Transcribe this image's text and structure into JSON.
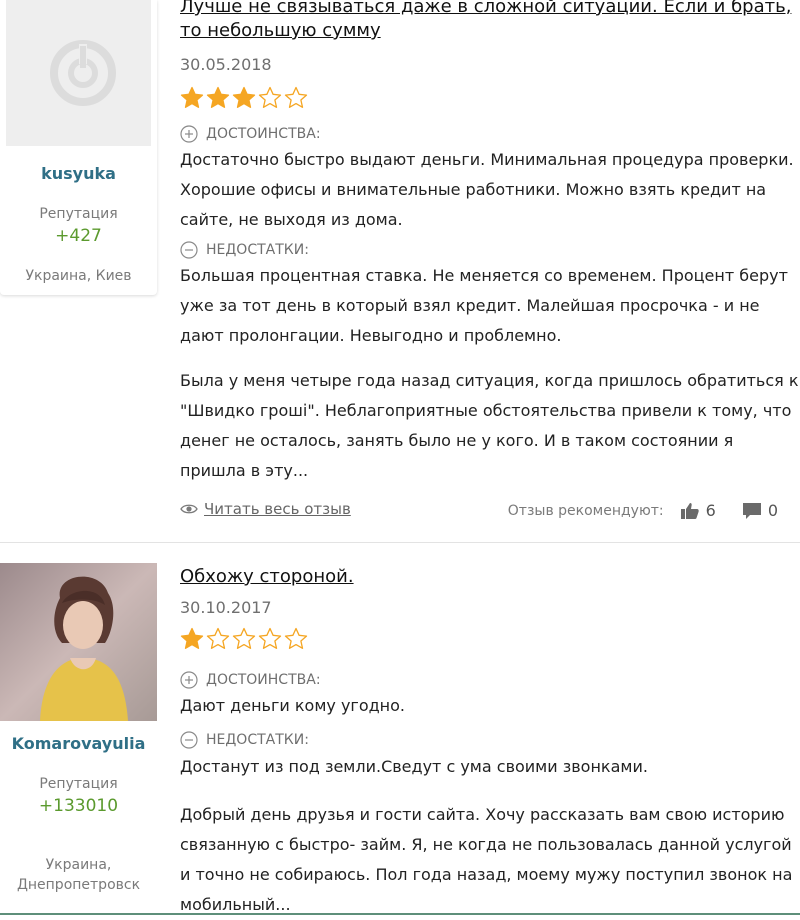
{
  "reviews": [
    {
      "author": {
        "name": "kusyuka",
        "reputation_label": "Репутация",
        "reputation": "+427",
        "city": "Украина, Киев"
      },
      "title": "Лучше не связываться даже в сложной ситуации. Если и брать,\nто небольшую сумму",
      "date": "30.05.2018",
      "rating": 3,
      "pros_label": "ДОСТОИНСТВА:",
      "pros": "Достаточно быстро выдают деньги. Минимальная процедура проверки. Хорошие офисы и внимательные работники. Можно взять кредит на сайте, не выходя из дома.",
      "cons_label": "НЕДОСТАТКИ:",
      "cons": "Большая процентная ставка. Не меняется со временем. Процент берут уже за тот день в который взял кредит. Малейшая просрочка - и не дают пролонгации. Невыгодно и проблемно.",
      "excerpt": "Была у меня четыре года назад ситуация, когда пришлось обратиться к \"Швидко гроші\". Неблагоприятные обстоятельства привели к тому, что денег не осталось, занять было не у кого. И в таком состоянии я пришла в эту...",
      "read_more": "Читать весь отзыв",
      "recommend_label": "Отзыв рекомендуют:",
      "likes": "6",
      "comments": "0"
    },
    {
      "author": {
        "name": "Komarovayulia",
        "reputation_label": "Репутация",
        "reputation": "+133010",
        "city": "Украина,\nДнепропетровск"
      },
      "title": "Обхожу стороной.",
      "date": "30.10.2017",
      "rating": 1,
      "pros_label": "ДОСТОИНСТВА:",
      "pros": "Дают деньги кому угодно.",
      "cons_label": "НЕДОСТАТКИ:",
      "cons": "Достанут из под земли.Сведут с ума своими звонками.",
      "excerpt": "Добрый день друзья и гости сайта. Хочу рассказать вам свою историю связанную с быстро- займ. Я, не когда не пользовалась данной услугой и точно не собираюсь. Пол года назад, моему мужу поступил звонок на мобильный..."
    }
  ],
  "colors": {
    "star": "#f5a623",
    "link_name": "#2f6f86",
    "reputation": "#5b9a2e"
  },
  "icons": [
    "plus-circle-icon",
    "minus-circle-icon",
    "eye-icon",
    "thumbs-up-icon",
    "comment-icon",
    "star-icon",
    "avatar-placeholder-icon"
  ]
}
